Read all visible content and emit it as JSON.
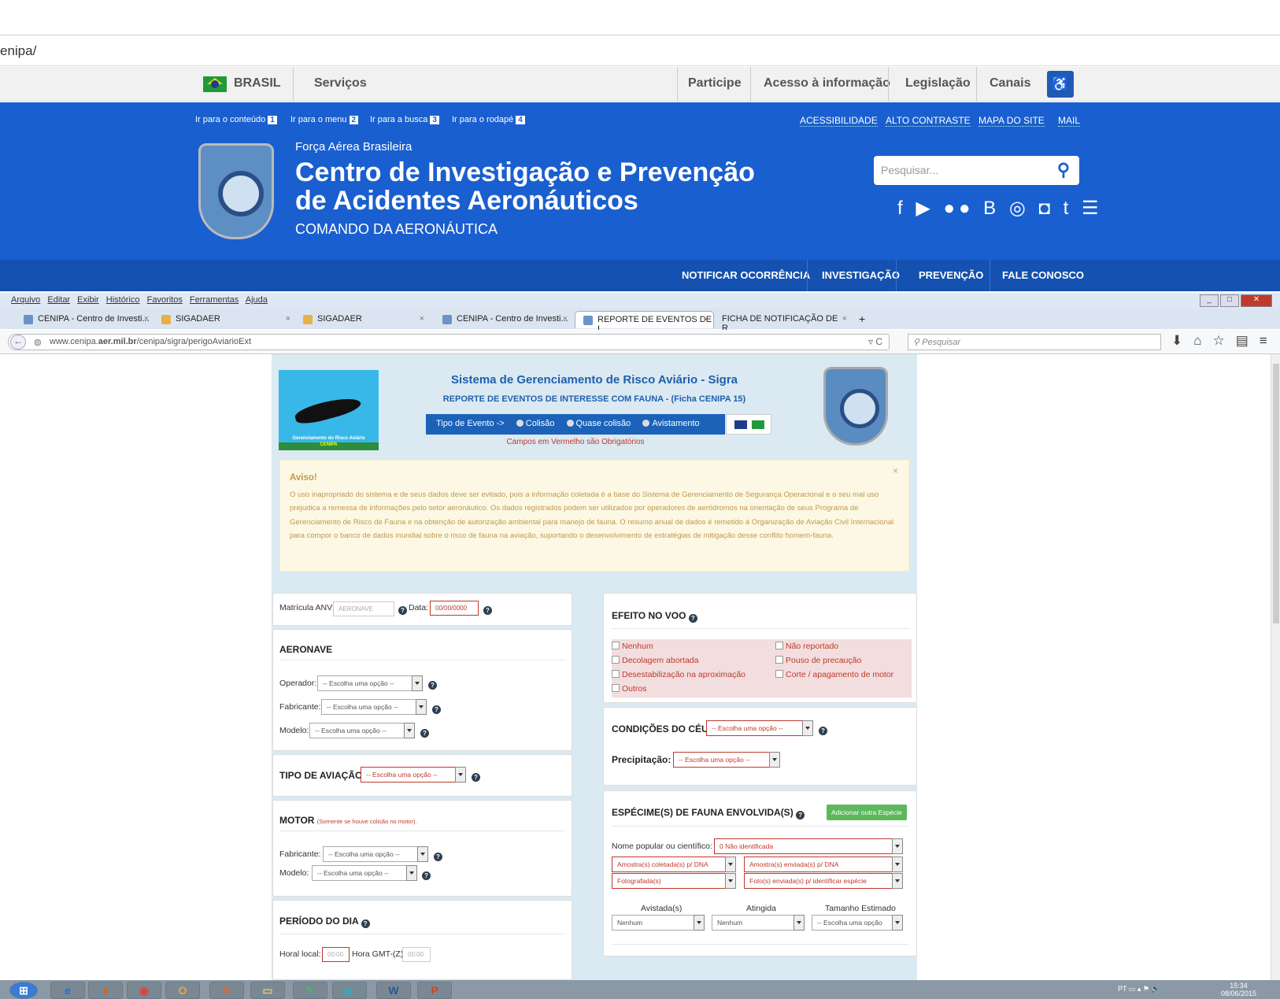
{
  "top_browser": {
    "url": "enipa/"
  },
  "gov_bar": {
    "brasil": "BRASIL",
    "servicos": "Serviços",
    "participe": "Participe",
    "acesso": "Acesso à informação",
    "legislacao": "Legislação",
    "canais": "Canais"
  },
  "skip_links": {
    "conteudo": "Ir para o conteúdo",
    "conteudo_n": "1",
    "menu": "Ir para o menu",
    "menu_n": "2",
    "busca": "Ir para a busca",
    "busca_n": "3",
    "rodape": "Ir para o rodapé",
    "rodape_n": "4"
  },
  "access_links": {
    "acessibilidade": "ACESSIBILIDADE",
    "alto": "ALTO CONTRASTE",
    "mapa": "MAPA DO SITE",
    "mail": "MAIL"
  },
  "header": {
    "sub": "Força Aérea Brasileira",
    "title1": "Centro de Investigação e Prevenção",
    "title2": "de Acidentes Aeronáuticos",
    "cmd": "COMANDO DA AERONÁUTICA",
    "search_placeholder": "Pesquisar...",
    "emblem": "CENIPA"
  },
  "nav": {
    "notificar": "NOTIFICAR OCORRÊNCIA",
    "investigacao": "INVESTIGAÇÃO",
    "prevencao": "PREVENÇÃO",
    "fale": "FALE CONOSCO"
  },
  "menubar": [
    "Arquivo",
    "Editar",
    "Exibir",
    "Histórico",
    "Favoritos",
    "Ferramentas",
    "Ajuda"
  ],
  "tabs": [
    {
      "label": "CENIPA - Centro de Investi..."
    },
    {
      "label": "SIGADAER"
    },
    {
      "label": "SIGADAER"
    },
    {
      "label": "CENIPA - Centro de Investi..."
    },
    {
      "label": "REPORTE DE EVENTOS DE I..."
    },
    {
      "label": "FICHA DE NOTIFICAÇÃO DE R..."
    }
  ],
  "address": {
    "url_pre": "www.cenipa.",
    "url_bold": "aer.mil.br",
    "url_post": "/cenipa/sigra/perigoAviarioExt",
    "search": "Pesquisar"
  },
  "sigra": {
    "logo_text": "Gerenciamento do Risco Aviário",
    "logo_text2": "CENIPA",
    "title": "Sistema de Gerenciamento de Risco Aviário - Sigra",
    "subtitle": "REPORTE DE EVENTOS DE INTERESSE COM FAUNA - (Ficha CENIPA 15)",
    "tipo": "Tipo de Evento ->",
    "colisao": "Colisão",
    "quase": "Quase colisão",
    "avistamento": "Avistamento",
    "required": "Campos em Vermelho são Obrigatórios",
    "aviso_title": "Aviso!",
    "aviso_text": "O uso inapropriado do sistema e de seus dados deve ser evitado, pois a informação coletada é a base do Sistema de Gerenciamento de Segurança Operacional e o seu mal uso prejudica a remessa de informações pelo setor aeronáutico. Os dados registrados podem ser utilizados por operadores de aeródromos na orientação de seus Programa de Gerenciamento de Risco de Fauna e na obtenção de autorização ambiental para manejo de fauna. O resumo anual de dados é remetido à Organização de Aviação Civil Internacional para compor o banco de dados mundial sobre o risco de fauna na aviação, suportando o desenvolvimento de estratégias de mitigação desse conflito homem-fauna.",
    "close": "×"
  },
  "form": {
    "matricula": "Matrícula ANV:",
    "matricula_ph": "AERONAVE",
    "data": "Data:",
    "data_ph": "00/00/0000",
    "aeronave": "AERONAVE",
    "operador": "Operador:",
    "fabricante": "Fabricante:",
    "modelo": "Modelo:",
    "escolha": "-- Escolha uma opção --",
    "tipo_aviacao": "TIPO DE AVIAÇÃO",
    "motor": "MOTOR",
    "motor_note": "(Somente se houve colisão no motor).",
    "periodo": "PERÍODO DO DIA",
    "hora_local": "Horal local:",
    "hora_gmt": "Hora GMT-(Z):",
    "hora_ph": "00:00",
    "efeito": "EFEITO NO VOO",
    "efeitos": [
      "Nenhum",
      "Não reportado",
      "Decolagem abortada",
      "Pouso de precaução",
      "Desestabilização na aproximação",
      "Corte / apagamento de motor",
      "Outros"
    ],
    "ceu": "CONDIÇÕES DO CÉU",
    "precip": "Precipitação:",
    "especime": "ESPÉCIME(S) DE FAUNA ENVOLVIDA(S)",
    "adicionar": "Adicionar outra Espécie",
    "nome_pop": "Nome popular ou científico:",
    "nao_ident": "0 Não identificada",
    "amostra_col": "Amostra(s) coletada(s) p/ DNA",
    "amostra_env": "Amostra(s) enviada(s) p/ DNA",
    "fotografada": "Fotografada(s)",
    "foto_env": "Foto(s) enviada(s) p/ identificar espécie",
    "avistada": "Avistada(s)",
    "atingida": "Atingida",
    "tamanho": "Tamanho Estimado",
    "nenhum": "Nenhum",
    "escolha_short": "-- Escolha uma opção"
  },
  "taskbar": {
    "lang": "PT",
    "time": "15:34",
    "date": "08/06/2015"
  }
}
